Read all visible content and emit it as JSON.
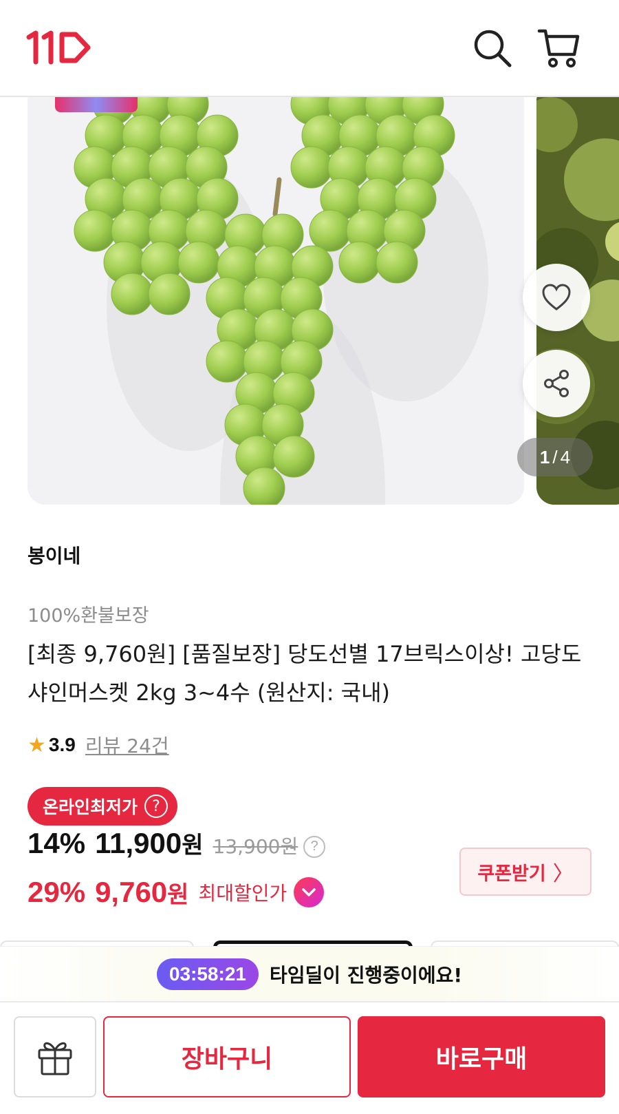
{
  "header": {
    "logo_text": "11",
    "brand_color": "#e5283f"
  },
  "gallery": {
    "current": "1",
    "separator": "/",
    "total": "4"
  },
  "product": {
    "seller": "봉이네",
    "tagline": "100%환불보장",
    "title": "[최종 9,760원] [품질보장] 당도선별 17브릭스이상! 고당도 샤인머스켓 2kg 3~4수 (원산지: 국내)",
    "rating": "3.9",
    "reviews": "리뷰 24건"
  },
  "price": {
    "badge": "온라인최저가",
    "badge_help": "?",
    "discount": "14%",
    "amount": "11,900",
    "won": "원",
    "original": "13,900원",
    "help": "?",
    "max_discount": "29%",
    "max_amount": "9,760",
    "max_won": "원",
    "max_label": "최대할인가"
  },
  "coupon": {
    "label": "쿠폰받기",
    "arrow": "〉"
  },
  "timedeal": {
    "timer": "03:58:21",
    "message": "타임딜이 진행중이에요!"
  },
  "bottom": {
    "cart_label": "장바구니",
    "buy_label": "바로구매"
  },
  "icons": [
    "search-icon",
    "cart-icon",
    "heart-icon",
    "share-icon",
    "chevron-down-icon",
    "gift-icon"
  ],
  "colors": {
    "accent": "#e5283f",
    "timer": "#7b52ee",
    "star": "#f4a71c"
  }
}
